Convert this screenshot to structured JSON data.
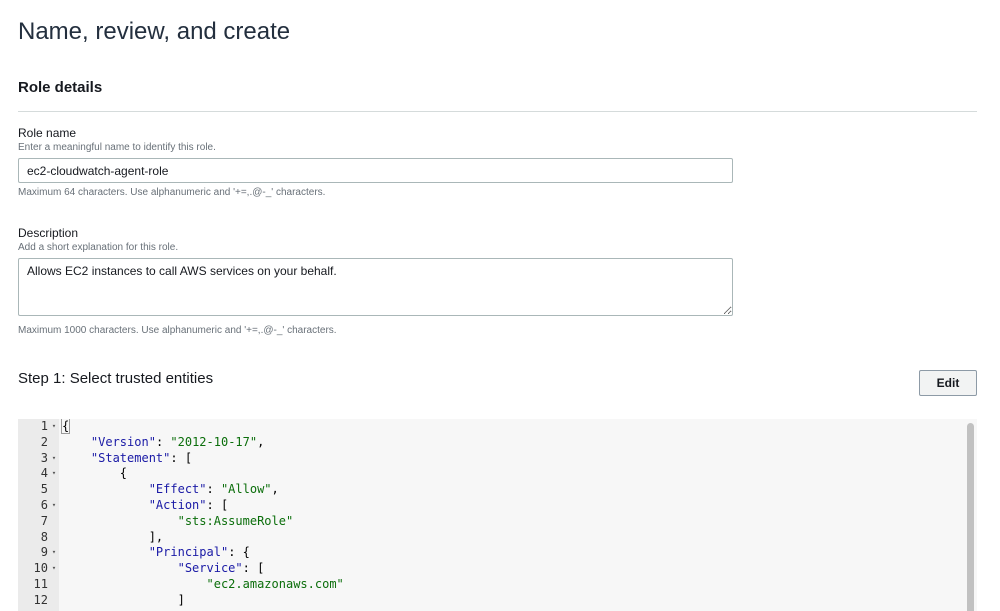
{
  "page": {
    "title": "Name, review, and create"
  },
  "role_details": {
    "heading": "Role details",
    "role_name": {
      "label": "Role name",
      "hint": "Enter a meaningful name to identify this role.",
      "value": "ec2-cloudwatch-agent-role",
      "constraint": "Maximum 64 characters. Use alphanumeric and '+=,.@-_' characters."
    },
    "description": {
      "label": "Description",
      "hint": "Add a short explanation for this role.",
      "value": "Allows EC2 instances to call AWS services on your behalf.",
      "constraint": "Maximum 1000 characters. Use alphanumeric and '+=,.@-_' characters."
    }
  },
  "step1": {
    "title": "Step 1: Select trusted entities",
    "edit_label": "Edit"
  },
  "policy_editor": {
    "lines": [
      {
        "num": "1",
        "fold": true,
        "tokens": [
          {
            "t": "punc",
            "v": "{"
          }
        ]
      },
      {
        "num": "2",
        "fold": false,
        "tokens": [
          {
            "t": "punc",
            "v": "    "
          },
          {
            "t": "key",
            "v": "\"Version\""
          },
          {
            "t": "punc",
            "v": ": "
          },
          {
            "t": "str",
            "v": "\"2012-10-17\""
          },
          {
            "t": "punc",
            "v": ","
          }
        ]
      },
      {
        "num": "3",
        "fold": true,
        "tokens": [
          {
            "t": "punc",
            "v": "    "
          },
          {
            "t": "key",
            "v": "\"Statement\""
          },
          {
            "t": "punc",
            "v": ": ["
          }
        ]
      },
      {
        "num": "4",
        "fold": true,
        "tokens": [
          {
            "t": "punc",
            "v": "        {"
          }
        ]
      },
      {
        "num": "5",
        "fold": false,
        "tokens": [
          {
            "t": "punc",
            "v": "            "
          },
          {
            "t": "key",
            "v": "\"Effect\""
          },
          {
            "t": "punc",
            "v": ": "
          },
          {
            "t": "str",
            "v": "\"Allow\""
          },
          {
            "t": "punc",
            "v": ","
          }
        ]
      },
      {
        "num": "6",
        "fold": true,
        "tokens": [
          {
            "t": "punc",
            "v": "            "
          },
          {
            "t": "key",
            "v": "\"Action\""
          },
          {
            "t": "punc",
            "v": ": ["
          }
        ]
      },
      {
        "num": "7",
        "fold": false,
        "tokens": [
          {
            "t": "punc",
            "v": "                "
          },
          {
            "t": "str",
            "v": "\"sts:AssumeRole\""
          }
        ]
      },
      {
        "num": "8",
        "fold": false,
        "tokens": [
          {
            "t": "punc",
            "v": "            ],"
          }
        ]
      },
      {
        "num": "9",
        "fold": true,
        "tokens": [
          {
            "t": "punc",
            "v": "            "
          },
          {
            "t": "key",
            "v": "\"Principal\""
          },
          {
            "t": "punc",
            "v": ": {"
          }
        ]
      },
      {
        "num": "10",
        "fold": true,
        "tokens": [
          {
            "t": "punc",
            "v": "                "
          },
          {
            "t": "key",
            "v": "\"Service\""
          },
          {
            "t": "punc",
            "v": ": ["
          }
        ]
      },
      {
        "num": "11",
        "fold": false,
        "tokens": [
          {
            "t": "punc",
            "v": "                    "
          },
          {
            "t": "str",
            "v": "\"ec2.amazonaws.com\""
          }
        ]
      },
      {
        "num": "12",
        "fold": false,
        "tokens": [
          {
            "t": "punc",
            "v": "                ]"
          }
        ]
      }
    ],
    "fold_glyph": "▾"
  }
}
